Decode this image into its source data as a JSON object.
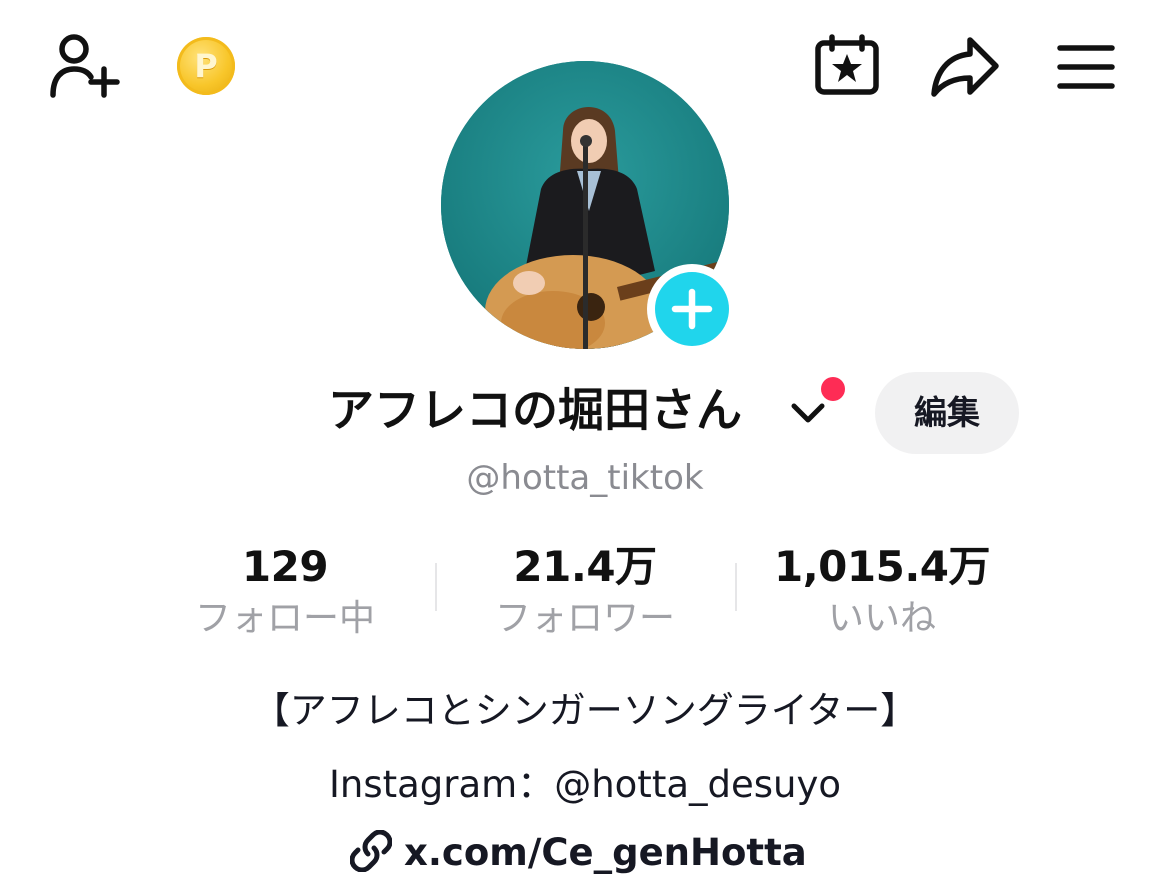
{
  "header": {
    "icons": [
      "add-friend-icon",
      "coin-icon",
      "calendar-star-icon",
      "share-icon",
      "menu-icon"
    ],
    "coin_letter": "P"
  },
  "profile": {
    "display_name": "アフレコの堀田さん",
    "username": "@hotta_tiktok",
    "edit_label": "編集",
    "accent_color": "#20d5ec",
    "notification_color": "#fe2c55"
  },
  "stats": {
    "following": {
      "value": "129",
      "label": "フォロー中"
    },
    "followers": {
      "value": "21.4万",
      "label": "フォロワー"
    },
    "likes": {
      "value": "1,015.4万",
      "label": "いいね"
    }
  },
  "bio": {
    "line1": "【アフレコとシンガーソングライター】",
    "line2": "Instagram：@hotta_desuyo",
    "link": "x.com/Ce_genHotta"
  }
}
